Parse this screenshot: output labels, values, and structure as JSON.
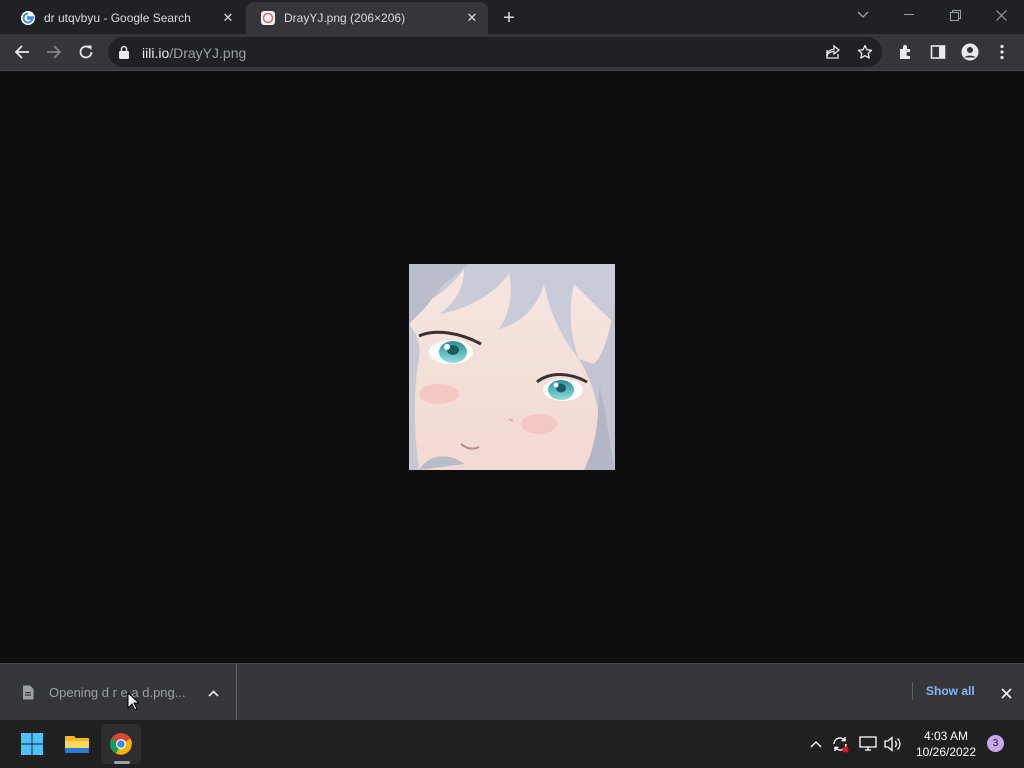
{
  "window": {
    "tabs": [
      {
        "title": "dr utqvbyu - Google Search",
        "favicon": "google-g-icon",
        "active": false
      },
      {
        "title": "DrayYJ.png (206×206)",
        "favicon": "image-favicon-icon",
        "active": true
      }
    ],
    "new_tab_label": "+"
  },
  "toolbar": {
    "url_host": "iili.io",
    "url_path": "/DrayYJ.png"
  },
  "viewer": {
    "image_alt": "DrayYJ.png"
  },
  "download_shelf": {
    "item_text": "Opening d r e a d.png...",
    "show_all_label": "Show all"
  },
  "taskbar": {
    "apps": [
      "start-icon",
      "file-explorer-icon",
      "chrome-icon"
    ],
    "time": "4:03 AM",
    "date": "10/26/2022",
    "notification_count": "3"
  },
  "colors": {
    "accent": "#8ab4f8",
    "tab_active": "#35363a",
    "tabstrip": "#202124",
    "page_bg": "#0e0e0e"
  }
}
